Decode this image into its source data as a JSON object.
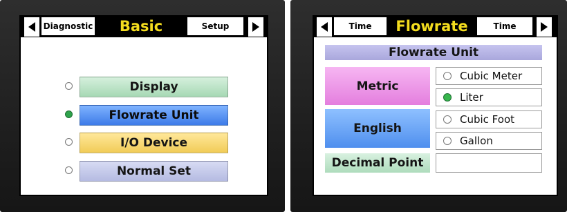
{
  "basic_screen": {
    "nav_left_label": "Diagnostic",
    "title": "Basic",
    "nav_right_label": "Setup",
    "menu": [
      {
        "label": "Display",
        "selected": false,
        "color": "#b8e2c4"
      },
      {
        "label": "Flowrate Unit",
        "selected": true,
        "color": "#5b93f5"
      },
      {
        "label": "I/O Device",
        "selected": false,
        "color": "#f6d870"
      },
      {
        "label": "Normal Set",
        "selected": false,
        "color": "#c7cbeb"
      }
    ]
  },
  "flowrate_screen": {
    "nav_left_label": "Time",
    "title": "Flowrate",
    "nav_right_label": "Time",
    "section_header": "Flowrate Unit",
    "categories": [
      {
        "label": "Metric",
        "color": "#ec95e8"
      },
      {
        "label": "English",
        "color": "#6aa4f6"
      }
    ],
    "decimal_point_label": "Decimal Point",
    "decimal_point_value": "",
    "options": [
      {
        "label": "Cubic Meter",
        "selected": false
      },
      {
        "label": "Liter",
        "selected": true
      },
      {
        "label": "Cubic Foot",
        "selected": false
      },
      {
        "label": "Gallon",
        "selected": false
      }
    ]
  },
  "colors": {
    "title_yellow": "#f3dc1e",
    "selected_radio": "#2fa34c"
  }
}
